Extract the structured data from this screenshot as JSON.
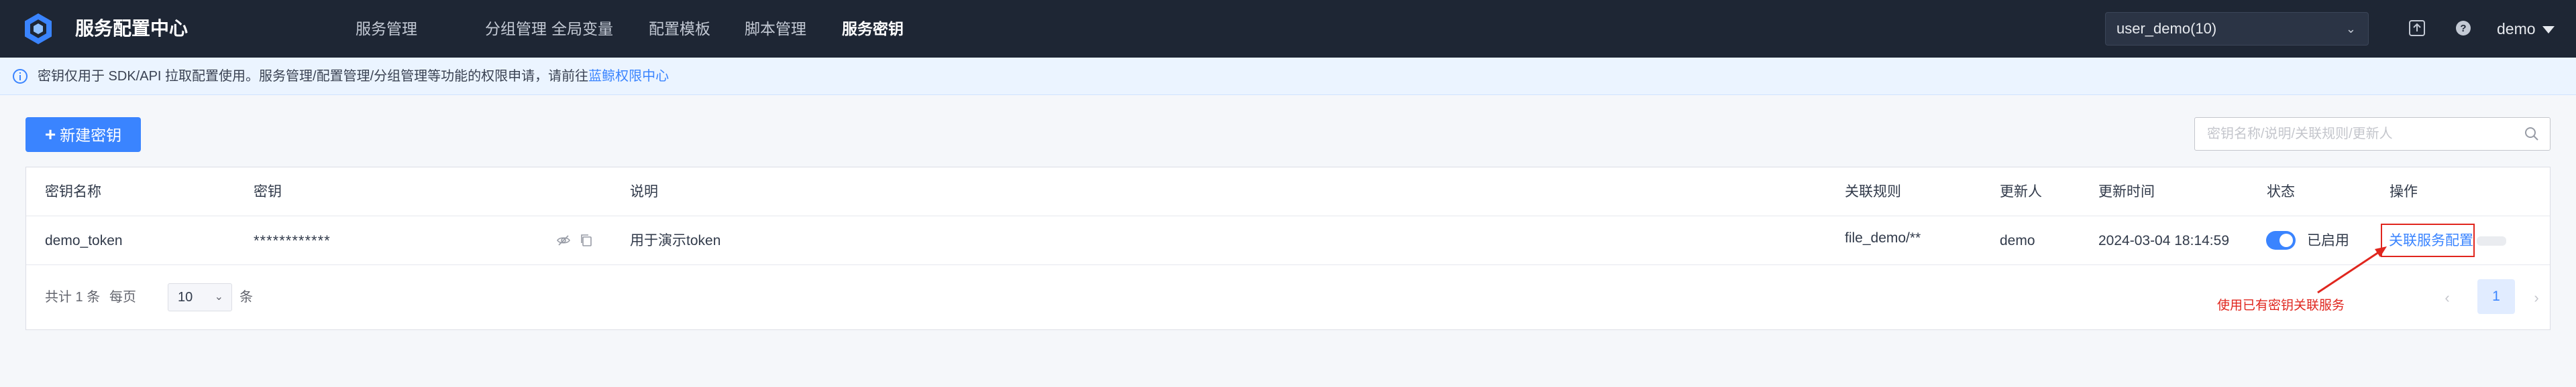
{
  "header": {
    "app_title": "服务配置中心",
    "nav": [
      "服务管理",
      "分组管理",
      "全局变量",
      "配置模板",
      "脚本管理",
      "服务密钥"
    ],
    "active_nav": "服务密钥",
    "business_select": "user_demo(10)",
    "user": "demo",
    "icons": [
      "logo-icon",
      "upload-icon",
      "help-icon"
    ]
  },
  "notice": {
    "text": "密钥仅用于 SDK/API 拉取配置使用。服务管理/配置管理/分组管理等功能的权限申请，请前往",
    "link": "蓝鲸权限中心"
  },
  "toolbar": {
    "create_label": "新建密钥",
    "search_placeholder": "密钥名称/说明/关联规则/更新人"
  },
  "table": {
    "columns": [
      "密钥名称",
      "密钥",
      "说明",
      "关联规则",
      "更新人",
      "更新时间",
      "状态",
      "操作"
    ],
    "rows": [
      {
        "name": "demo_token",
        "key": "************",
        "description": "用于演示token",
        "rule": "file_demo/**",
        "updater": "demo",
        "updated_at": "2024-03-04 18:14:59",
        "status": "已启用",
        "enabled": true,
        "action": "关联服务配置"
      }
    ]
  },
  "pagination": {
    "total_label": "共计 1 条",
    "per_page_label": "每页",
    "per_page": "10",
    "unit": "条",
    "current_page": "1"
  },
  "annotation": {
    "text": "使用已有密钥关联服务",
    "color": "#e0261e"
  },
  "colors": {
    "primary": "#3a84ff",
    "nav_bg": "#1e2634"
  }
}
